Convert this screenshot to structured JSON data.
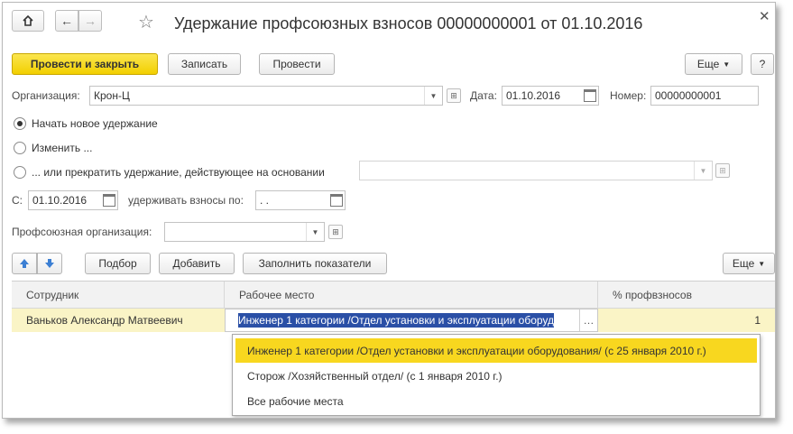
{
  "window": {
    "title": "Удержание профсоюзных взносов 00000000001 от 01.10.2016",
    "close_symbol": "✕"
  },
  "toolbar": {
    "post_close_label": "Провести и закрыть",
    "save_label": "Записать",
    "post_label": "Провести",
    "more_label": "Еще",
    "help_label": "?"
  },
  "form": {
    "organization_label": "Организация:",
    "organization_value": "Крон-Ц",
    "date_label": "Дата:",
    "date_value": "01.10.2016",
    "number_label": "Номер:",
    "number_value": "00000000001",
    "radio_options": [
      {
        "label": "Начать новое удержание",
        "selected": true
      },
      {
        "label": "Изменить ...",
        "selected": false
      },
      {
        "label": "... или прекратить удержание, действующее на основании",
        "selected": false
      }
    ],
    "from_label": "С:",
    "from_value": "01.10.2016",
    "until_label": "удерживать взносы по:",
    "until_value": " .  .",
    "union_label": "Профсоюзная организация:",
    "union_value": ""
  },
  "table_toolbar": {
    "select_label": "Подбор",
    "add_label": "Добавить",
    "fill_label": "Заполнить показатели",
    "more_label": "Еще"
  },
  "table": {
    "columns": [
      "Сотрудник",
      "Рабочее место",
      "% профвзносов"
    ],
    "rows": [
      {
        "employee": "Ваньков Александр Матвеевич",
        "workplace": "Инженер 1 категории /Отдел установки и эксплуатации оборуд",
        "percent": "1"
      }
    ]
  },
  "dropdown": {
    "options": [
      {
        "label": "Инженер 1 категории /Отдел установки и эксплуатации оборудования/ (с 25 января 2010 г.)",
        "selected": true
      },
      {
        "label": "Сторож /Хозяйственный отдел/ (с 1 января 2010 г.)",
        "selected": false
      },
      {
        "label": "Все рабочие места",
        "selected": false
      }
    ]
  },
  "colors": {
    "primary_button": "#f5d400",
    "selected_row": "#faf4c6",
    "selection_highlight": "#2a4fa6",
    "dropdown_selected": "#f8d71f"
  }
}
